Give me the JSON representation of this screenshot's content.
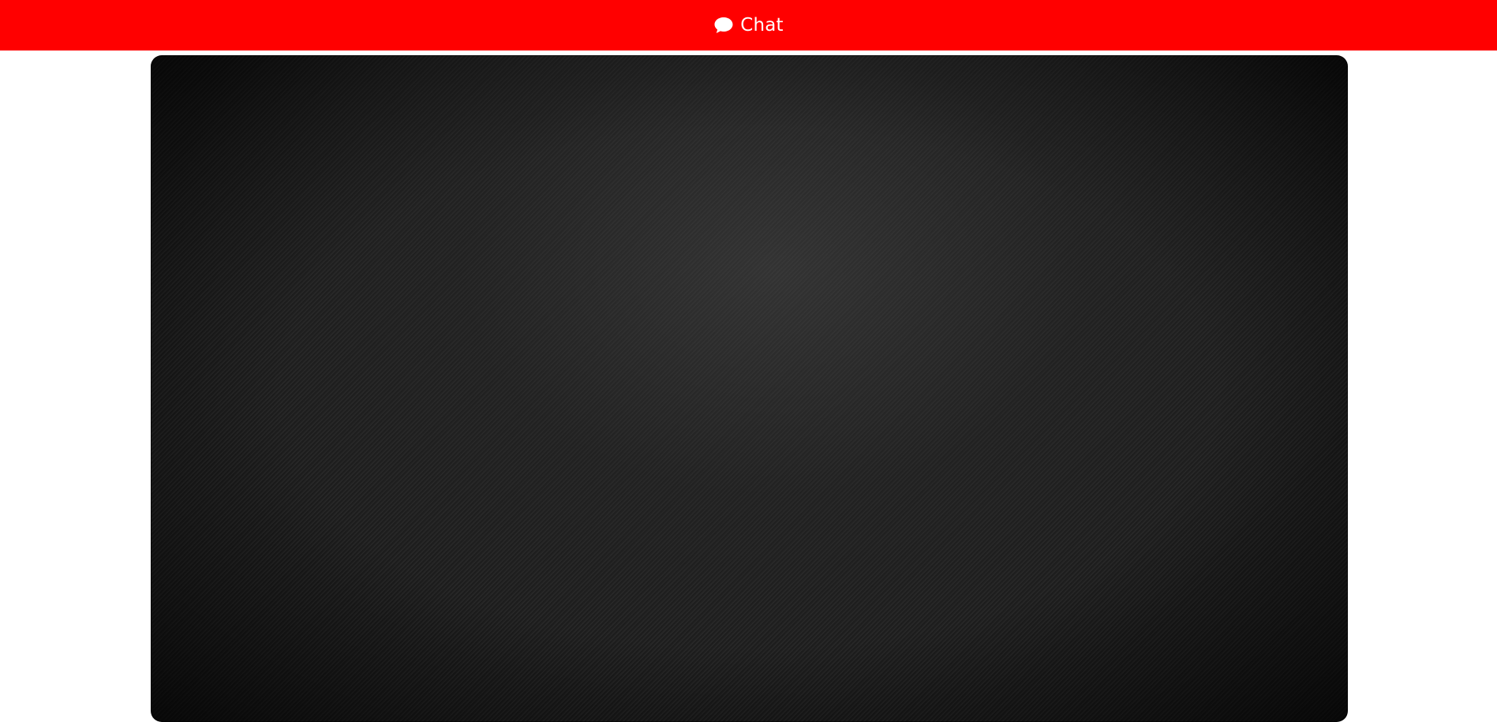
{
  "header": {
    "title": "Chat",
    "icon": "chat-bubble-icon",
    "background_color": "#ff0000",
    "text_color": "#ffffff"
  },
  "panel": {
    "background_color": "#1e1e1e"
  }
}
